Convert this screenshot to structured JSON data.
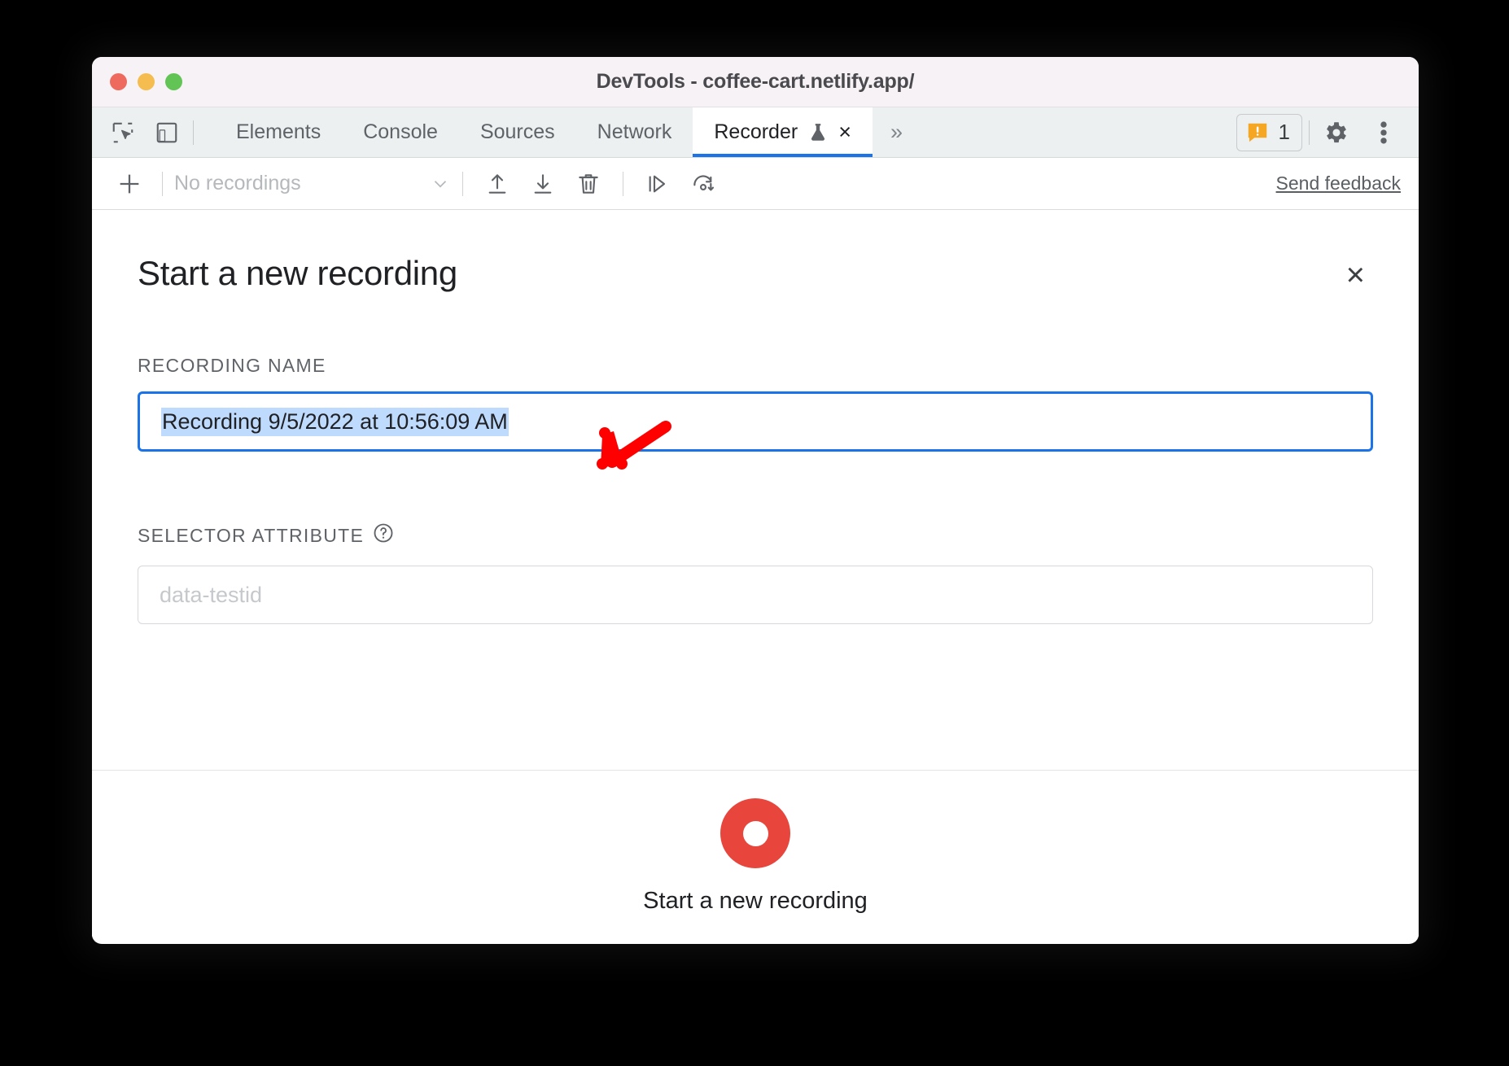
{
  "window": {
    "title": "DevTools - coffee-cart.netlify.app/",
    "traffic_lights": [
      "close",
      "minimize",
      "zoom"
    ]
  },
  "tabbar": {
    "left_icons": [
      {
        "name": "inspect-element-icon",
        "label": "Inspect element"
      },
      {
        "name": "device-toolbar-icon",
        "label": "Toggle device toolbar"
      }
    ],
    "tabs": [
      {
        "label": "Elements",
        "selected": false
      },
      {
        "label": "Console",
        "selected": false
      },
      {
        "label": "Sources",
        "selected": false
      },
      {
        "label": "Network",
        "selected": false
      },
      {
        "label": "Recorder",
        "selected": true,
        "experiment": true,
        "closable": true
      }
    ],
    "overflow_label": "»",
    "tab_close_label": "×",
    "warnings": {
      "count": "1",
      "color": "#f5a623"
    },
    "settings_label": "Settings",
    "more_label": "Customize and control DevTools"
  },
  "recorder_toolbar": {
    "add_label": "+",
    "select_value": "No recordings",
    "chevron": "chevron-down-icon",
    "actions": [
      {
        "name": "import-recording-icon",
        "label": "Import recording"
      },
      {
        "name": "export-recording-icon",
        "label": "Export recording"
      },
      {
        "name": "delete-recording-icon",
        "label": "Delete recording"
      },
      {
        "name": "replay-step-icon",
        "label": "Replay step by step"
      },
      {
        "name": "replay-speed-icon",
        "label": "Replay speed"
      }
    ],
    "feedback_label": "Send feedback"
  },
  "panel": {
    "title": "Start a new recording",
    "close_label": "×",
    "recording_name": {
      "label": "RECORDING NAME",
      "value": "Recording 9/5/2022 at 10:56:09 AM",
      "selected": true,
      "focused": true,
      "selection_color": "#bedafc",
      "focus_border_color": "#1a73e8"
    },
    "selector_attribute": {
      "label": "SELECTOR ATTRIBUTE",
      "help_icon": "help-circle-icon",
      "value": "",
      "placeholder": "data-testid"
    }
  },
  "footer": {
    "record_button_label": "Start a new recording",
    "record_button_color": "#e8453c"
  },
  "annotation": {
    "arrow": "red-arrow-pointing-down-left",
    "color": "#ff0000"
  }
}
